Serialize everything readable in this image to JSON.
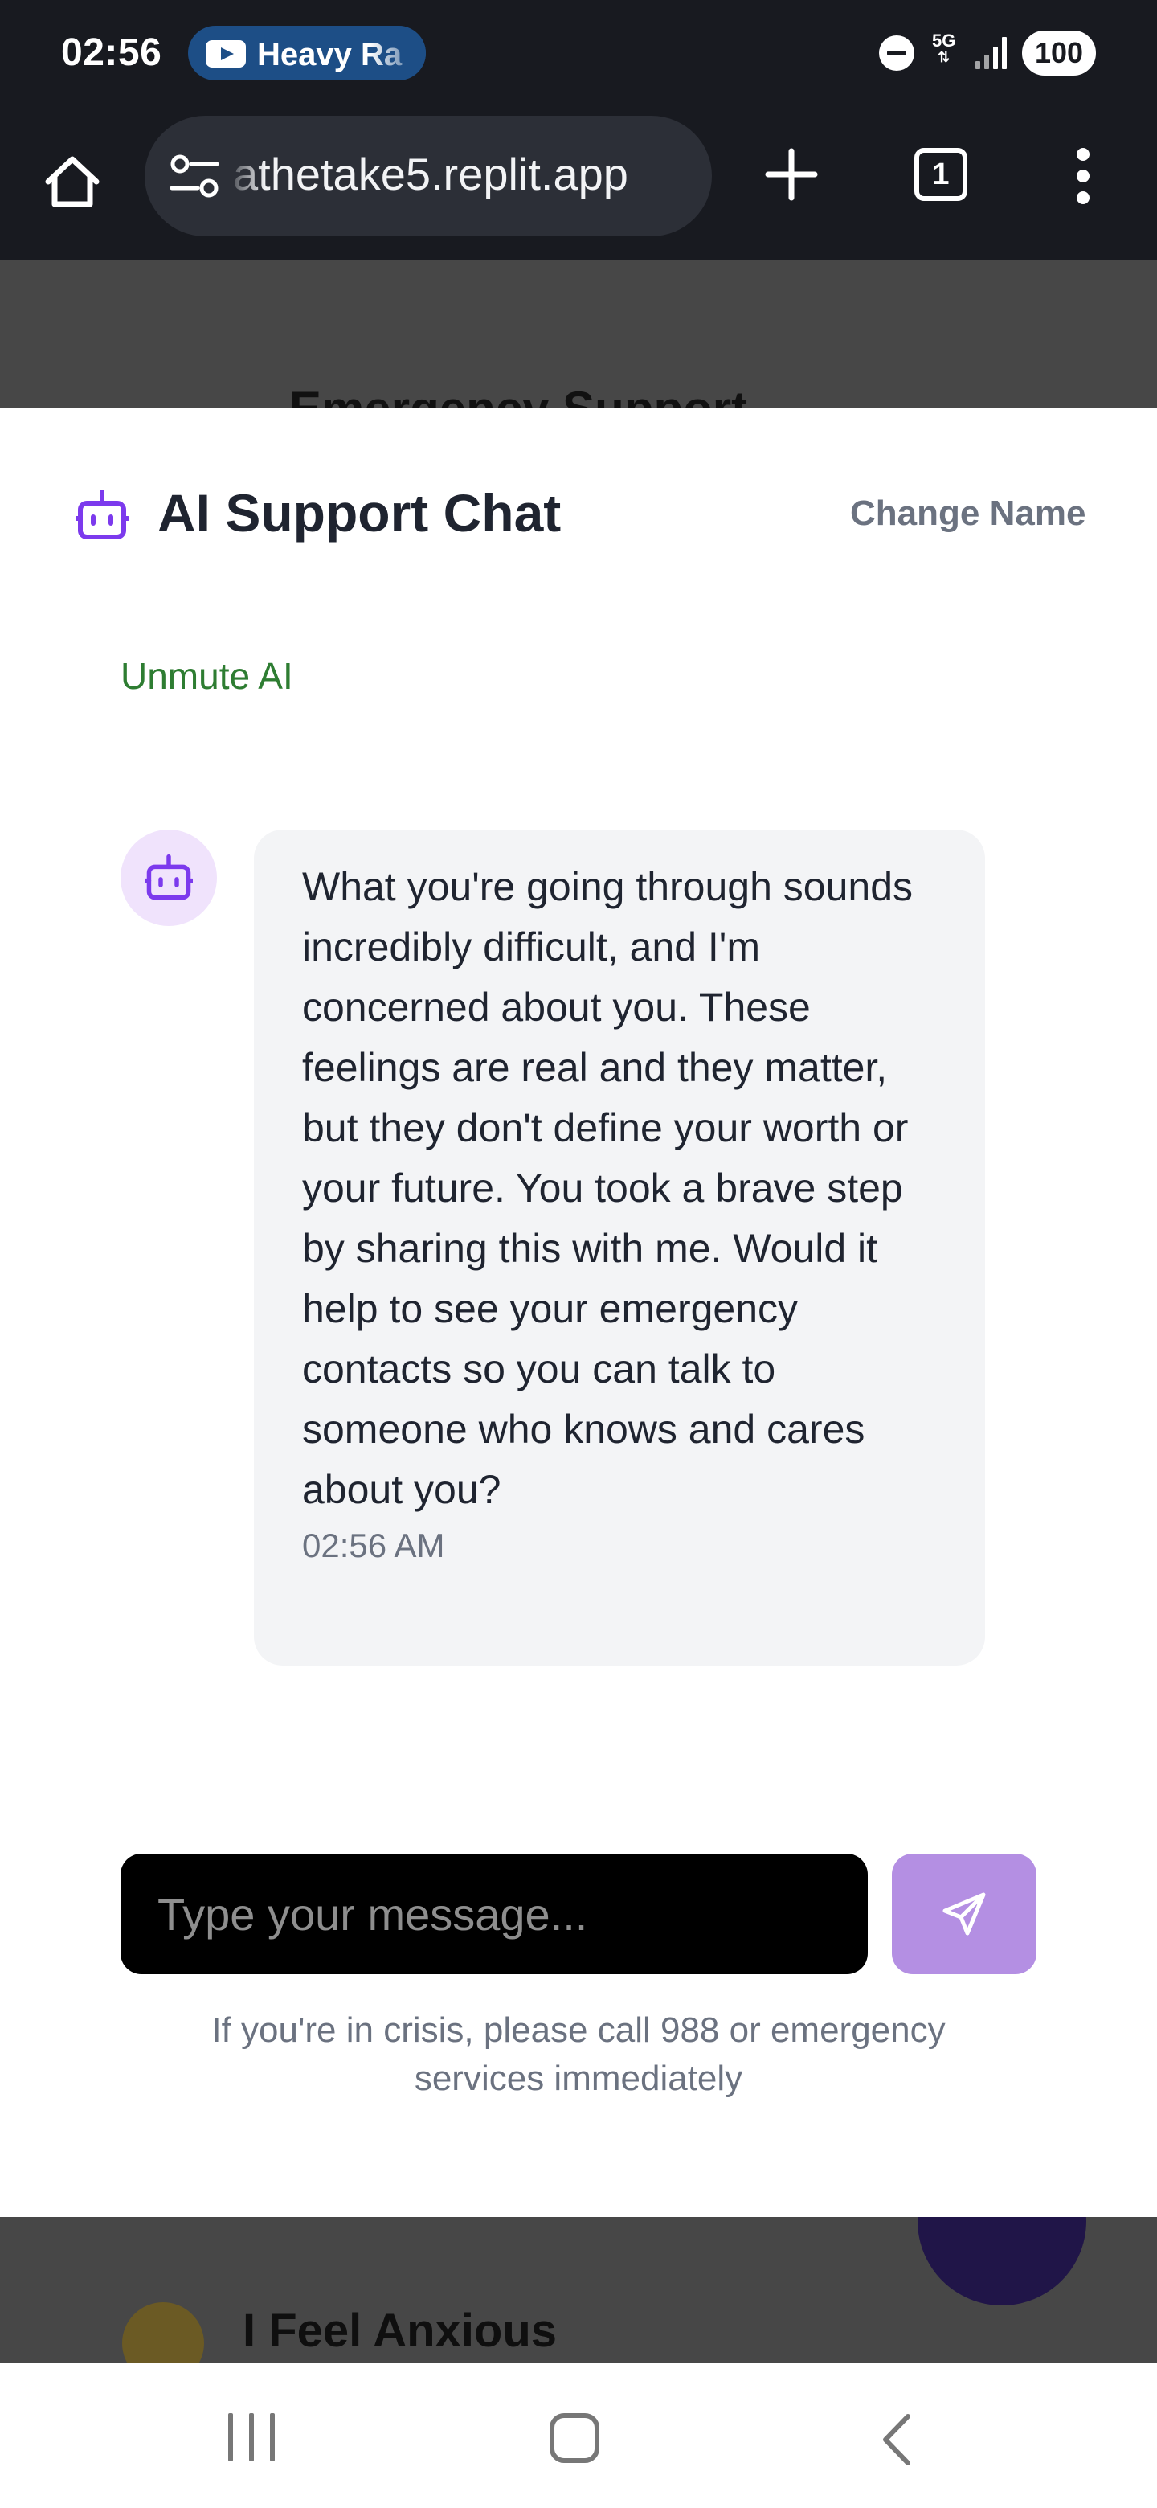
{
  "status_bar": {
    "time": "02:56",
    "media_pill_text": "Heavy Ra",
    "network": "5G",
    "battery": "100"
  },
  "browser": {
    "url": "athetake5.replit.app",
    "tab_count": "1"
  },
  "background_page": {
    "section_title_partial": "Emergency Support",
    "card_title": "I Feel Anxious"
  },
  "modal": {
    "title": "AI Support Chat",
    "change_name_label": "Change Name",
    "unmute_label": "Unmute AI",
    "messages": [
      {
        "sender": "ai",
        "text": "What you're going through sounds incredibly difficult, and I'm concerned about you. These feelings are real and they matter, but they don't define your worth or your future. You took a brave step by sharing this with me. Would it help to see your emergency contacts so you can talk to someone who knows and cares about you?",
        "time": "02:56 AM"
      }
    ],
    "input": {
      "placeholder": "Type your message...",
      "value": ""
    },
    "crisis_note": "If you're in crisis, please call 988 or emergency services immediately"
  },
  "colors": {
    "accent_purple": "#7c3aed",
    "send_button": "#b48fe3",
    "unmute_green": "#2e7d32",
    "bubble_bg": "#f3f4f6"
  },
  "icons": {
    "header": "bot-icon",
    "avatar": "bot-icon",
    "send": "send-icon"
  }
}
